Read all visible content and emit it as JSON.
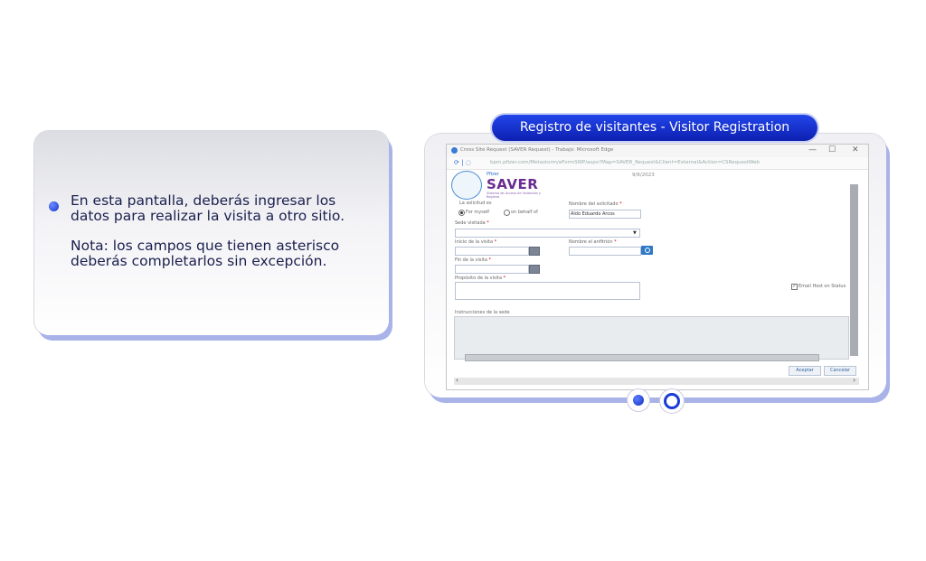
{
  "info": {
    "paragraph1": "En esta pantalla, deberás ingresar los datos para realizar la visita a otro sitio.",
    "paragraph2": "Nota: los campos que tienen asterisco deberás completarlos sin excepción."
  },
  "slide_title": "Registro de visitantes - Visitor Registration",
  "browser": {
    "window_title": "Cross Site Request (SAVER Request) - Trabajo: Microsoft Edge",
    "url": "bpm.pfizer.com/Metastorm/eFormSWP/aspx?Map=SAVER_Request&Client=External&Action=CSRequestWeb",
    "controls": [
      "—",
      "☐",
      "✕"
    ]
  },
  "logo": {
    "company": "Pfizer",
    "brand": "SAVER",
    "subtitle": "Sistema de Acceso de Visitantes y Registro"
  },
  "form": {
    "date": "9/6/2023",
    "solicitante_label": "La solicitud es",
    "radio_options": [
      "For myself",
      "on behalf of"
    ],
    "nombre_label": "Nombre del solicitado",
    "nombre_value": "Aldo Eduardo Arcos",
    "sede_label": "Sede visitada",
    "inicio_label": "Inicio de la visita",
    "anfitrion_label": "Nombre el anfitrión",
    "fin_label": "Fin de la visita",
    "proposito_label": "Propósito de la visita",
    "email_label": "Email Host on Status",
    "comentarios_label": "Instrucciones de la sede",
    "required_mark": "*",
    "accept_button": "Aceptar",
    "cancel_button": "Cancelar"
  }
}
